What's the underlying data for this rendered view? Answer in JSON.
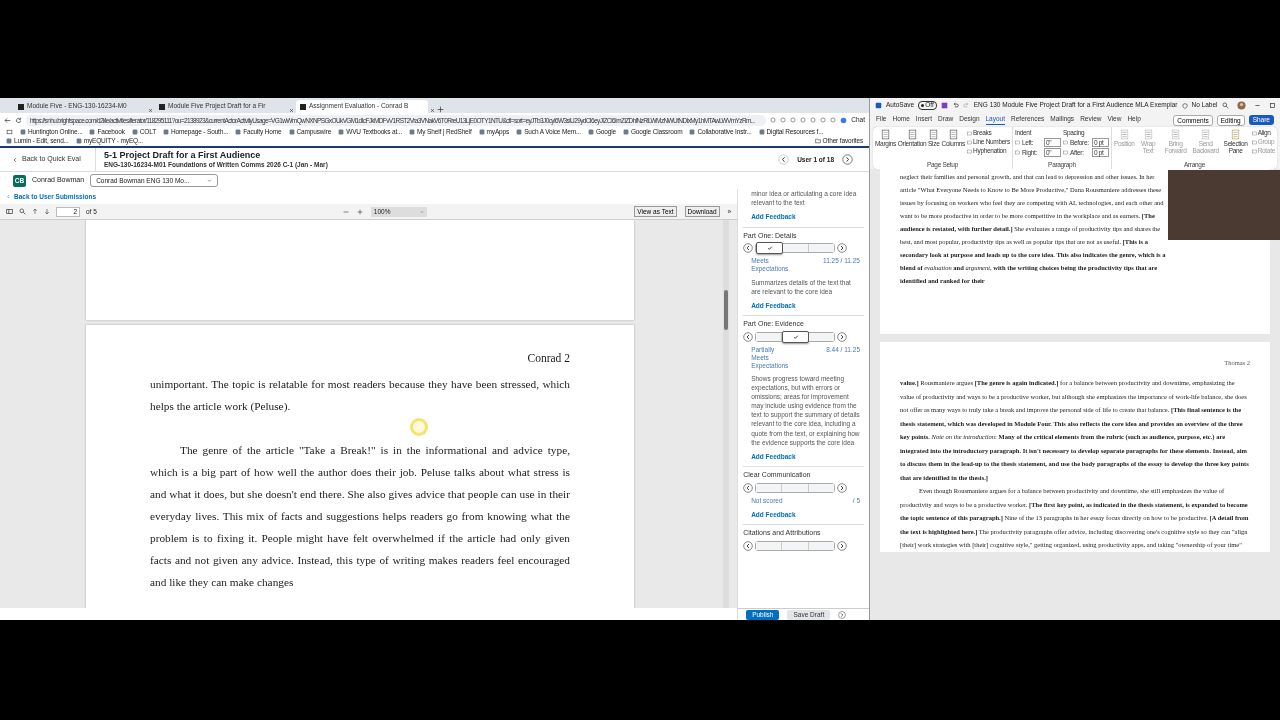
{
  "browser": {
    "tabs": [
      {
        "label": "Module Five - ENG-130-16234-M0",
        "selected": false
      },
      {
        "label": "Module Five Project Draft for a Fir",
        "selected": false
      },
      {
        "label": "Assignment Evaluation - Conrad B",
        "selected": true
      }
    ],
    "address": "https://snhu.brightspace.com/d2l/le/activities/iterator/118295111?ou=2138923&currentActorActivityUsage=VG1wWmQwNXNPSGxOUkVGM1dIcFJkMDFvV1RST2Vra3VNakV6T0RreU13LjE0OTY1NTU&cfi=sort=eyJTb3J0cyI6W3siU29ydCI6eyJIZCI6ImZiZDhlNzRlLWMzNWUtNDIxMy1hMTAwLWVmYzRm...",
    "chat": "Chat",
    "bookmarks": [
      "Huntington Online...",
      "Facebook",
      "COLT",
      "Homepage - South...",
      "Faculty Home",
      "Campuswire",
      "WVU Textbooks at...",
      "My Shelf | RedShelf",
      "myApps",
      "Such A Voice Mem...",
      "Google",
      "Google Classroom",
      "Collaborative Instr...",
      "Digital Resources f...",
      "Lumin - Edit, send...",
      "myEQUITY - myEQ..."
    ],
    "other_favorites": "Other favorites"
  },
  "page_header": {
    "back": "Back to Quick Eval",
    "title": "5-1 Project Draft for a First Audience",
    "subtitle": "ENG-130-16234-M01 Foundations of Written Comms 2026 C-1 (Jan - Mar)",
    "user_counter": "User 1 of 18"
  },
  "student": {
    "initials": "CB",
    "name": "Conrad Bowman",
    "select_value": "Conrad Bowman ENG 130 Mo..."
  },
  "back_link": "Back to User Submissions",
  "pdf_toolbar": {
    "page": "2",
    "page_total": "of 5",
    "zoom": "100%",
    "buttons": [
      "View as Text",
      "Download"
    ],
    "more": "»"
  },
  "document": {
    "header": "Conrad 2",
    "paragraphs": [
      {
        "indent": false,
        "text": "unimportant. The topic is relatable for most readers because they have been stressed, which helps the article work (Peluse)."
      },
      {
        "indent": true,
        "text": "The genre of the article \"Take a Break!\" is in the informational and advice type, which is a big part of how well the author does their job. Peluse talks about what stress is and what it does, but she doesn't end there. She also gives advice that people can use in their everyday lives. This mix of facts and suggestions helps readers go from knowing what the problem is to fixing it. People might have felt overwhelmed if the article had only given facts and not given any advice. Instead, this type of writing makes readers feel encouraged and like they can make changes"
      }
    ]
  },
  "rubric": {
    "top_fragment": "minor idea or articulating a core idea relevant to the text",
    "top_feedback": "Add Feedback",
    "criteria": [
      {
        "title": "Part One: Details",
        "levels": [
          {
            "selected": true
          },
          {
            "selected": false
          },
          {
            "selected": false
          }
        ],
        "level_name": "Meets Expectations",
        "score": "11.25 / 11.25",
        "description": "Summarizes details of the text that are relevant to the core idea",
        "feedback": "Add Feedback"
      },
      {
        "title": "Part One: Evidence",
        "levels": [
          {
            "selected": false
          },
          {
            "selected": true
          },
          {
            "selected": false
          }
        ],
        "level_name": "Partially Meets Expectations",
        "score": "8.44 / 11.25",
        "description": "Shows progress toward meeting expectations, but with errors or omissions; areas for improvement may include using evidence from the text to support the summary of details relevant to the core idea, including a quote from the text, or explaining how the evidence supports the core idea",
        "feedback": "Add Feedback"
      },
      {
        "title": "Clear Communication",
        "levels": [
          {
            "selected": false
          },
          {
            "selected": false
          },
          {
            "selected": false
          }
        ],
        "level_name": "Not scored",
        "score": "/ 5",
        "feedback": "Add Feedback"
      },
      {
        "title": "Citations and Attributions",
        "levels": [
          {
            "selected": false
          },
          {
            "selected": false
          },
          {
            "selected": false
          }
        ]
      }
    ],
    "publish": "Publish",
    "save_draft": "Save Draft"
  },
  "word": {
    "autosave": "AutoSave",
    "autosave_state": "Off",
    "title": "ENG 130 Module Five Project Draft for a First Audience MLA Exemplar",
    "label": "No Label",
    "menu": [
      {
        "label": "File",
        "selected": false
      },
      {
        "label": "Home",
        "selected": false
      },
      {
        "label": "Insert",
        "selected": false
      },
      {
        "label": "Draw",
        "selected": false
      },
      {
        "label": "Design",
        "selected": false
      },
      {
        "label": "Layout",
        "selected": true
      },
      {
        "label": "References",
        "selected": false
      },
      {
        "label": "Mailings",
        "selected": false
      },
      {
        "label": "Review",
        "selected": false
      },
      {
        "label": "View",
        "selected": false
      },
      {
        "label": "Help",
        "selected": false
      }
    ],
    "comments": "Comments",
    "editing": "Editing",
    "share": "Share",
    "page_setup": {
      "label": "Page Setup",
      "buttons": [
        "Margins",
        "Orientation",
        "Size",
        "Columns"
      ],
      "menu_items": [
        "Breaks",
        "Line Numbers",
        "Hyphenation"
      ]
    },
    "paragraph": {
      "label": "Paragraph",
      "indent_title": "Indent",
      "spacing_title": "Spacing",
      "indent_fields": [
        {
          "label": "Left:",
          "value": "0\""
        },
        {
          "label": "Right:",
          "value": "0\""
        }
      ],
      "spacing_fields": [
        {
          "label": "Before:",
          "value": "0 pt"
        },
        {
          "label": "After:",
          "value": "0 pt"
        }
      ]
    },
    "arrange": {
      "label": "Arrange",
      "buttons": [
        {
          "label": "Position",
          "disabled": true
        },
        {
          "label": "Wrap Text",
          "disabled": true
        },
        {
          "label": "Bring Forward",
          "disabled": true
        },
        {
          "label": "Send Backward",
          "disabled": true
        },
        {
          "label": "Selection Pane",
          "disabled": false
        }
      ],
      "menu_items": [
        {
          "label": "Align",
          "disabled": false
        },
        {
          "label": "Group",
          "disabled": true
        },
        {
          "label": "Rotate",
          "disabled": true
        }
      ]
    },
    "pages": [
      {
        "paragraphs": [
          {
            "indent": false,
            "text": "neglect their families and personal growth, and that can lead to depression and other issues. In her article \"What Everyone Needs to Know to Be More Productive,\" Dana Rousmaniere addresses these issues by focusing on workers who feel they are competing with AI, technologies, and each other and want to be more productive in order to be more competitive in the workplace and as earners. **[The audience is restated, with further detail.]** She evaluates a range of productivity tips and shares the best, and most popular, productivity tips as well as popular tips that are not as useful. **[This is a secondary look at purpose and leads up to the core idea. This also indicates the genre, which is a blend of** *evaluation* **and** *argument*, **with the writing choices being the productivity tips that are identified and ranked for their**"
          }
        ]
      },
      {
        "header": "Thomas 2",
        "paragraphs": [
          {
            "indent": false,
            "text": "**value.]** Rousmaniere argues **[The genre is again indicated.]** for a balance between productivity and downtime, emphasizing the value of productivity and ways to be a productive worker, but although she emphasizes the importance of work-life balance, she does not offer as many ways to truly take a break and improve the personal side of life to create that balance. **[This final sentence is the thesis statement, which was developed in Module Four. This also reflects the core idea and provides an overview of the three key points.** *Note on the introduction*: **Many of the critical elements from the rubric (such as audience, purpose, etc.) are integrated into the introductory paragraph. It isn't necessary to develop separate paragraphs for these elements. Instead, aim to discuss them in the lead-up to the thesis statement, and use the body paragraphs of the essay to develop the three key points that are identified in the thesis.]**"
          },
          {
            "indent": true,
            "text": "Even though Rousmaniere argues for a balance between productivity and downtime, she still emphasizes the value of productivity and ways to be a productive worker. **[The first key point, as indicated in the thesis statement, is expanded to become the topic sentence of this paragraph.]** Nine of the 13 paragraphs in her essay focus directly on how to be productive. **[A detail from the text is highlighted here.]** The productivity paragraphs offer advice, including discovering one's cognitive style so they can \"align [their] work strategies with [their] cognitive style,\" getting organized, using productivity apps, and taking \"ownership of your time\""
          }
        ]
      }
    ]
  }
}
